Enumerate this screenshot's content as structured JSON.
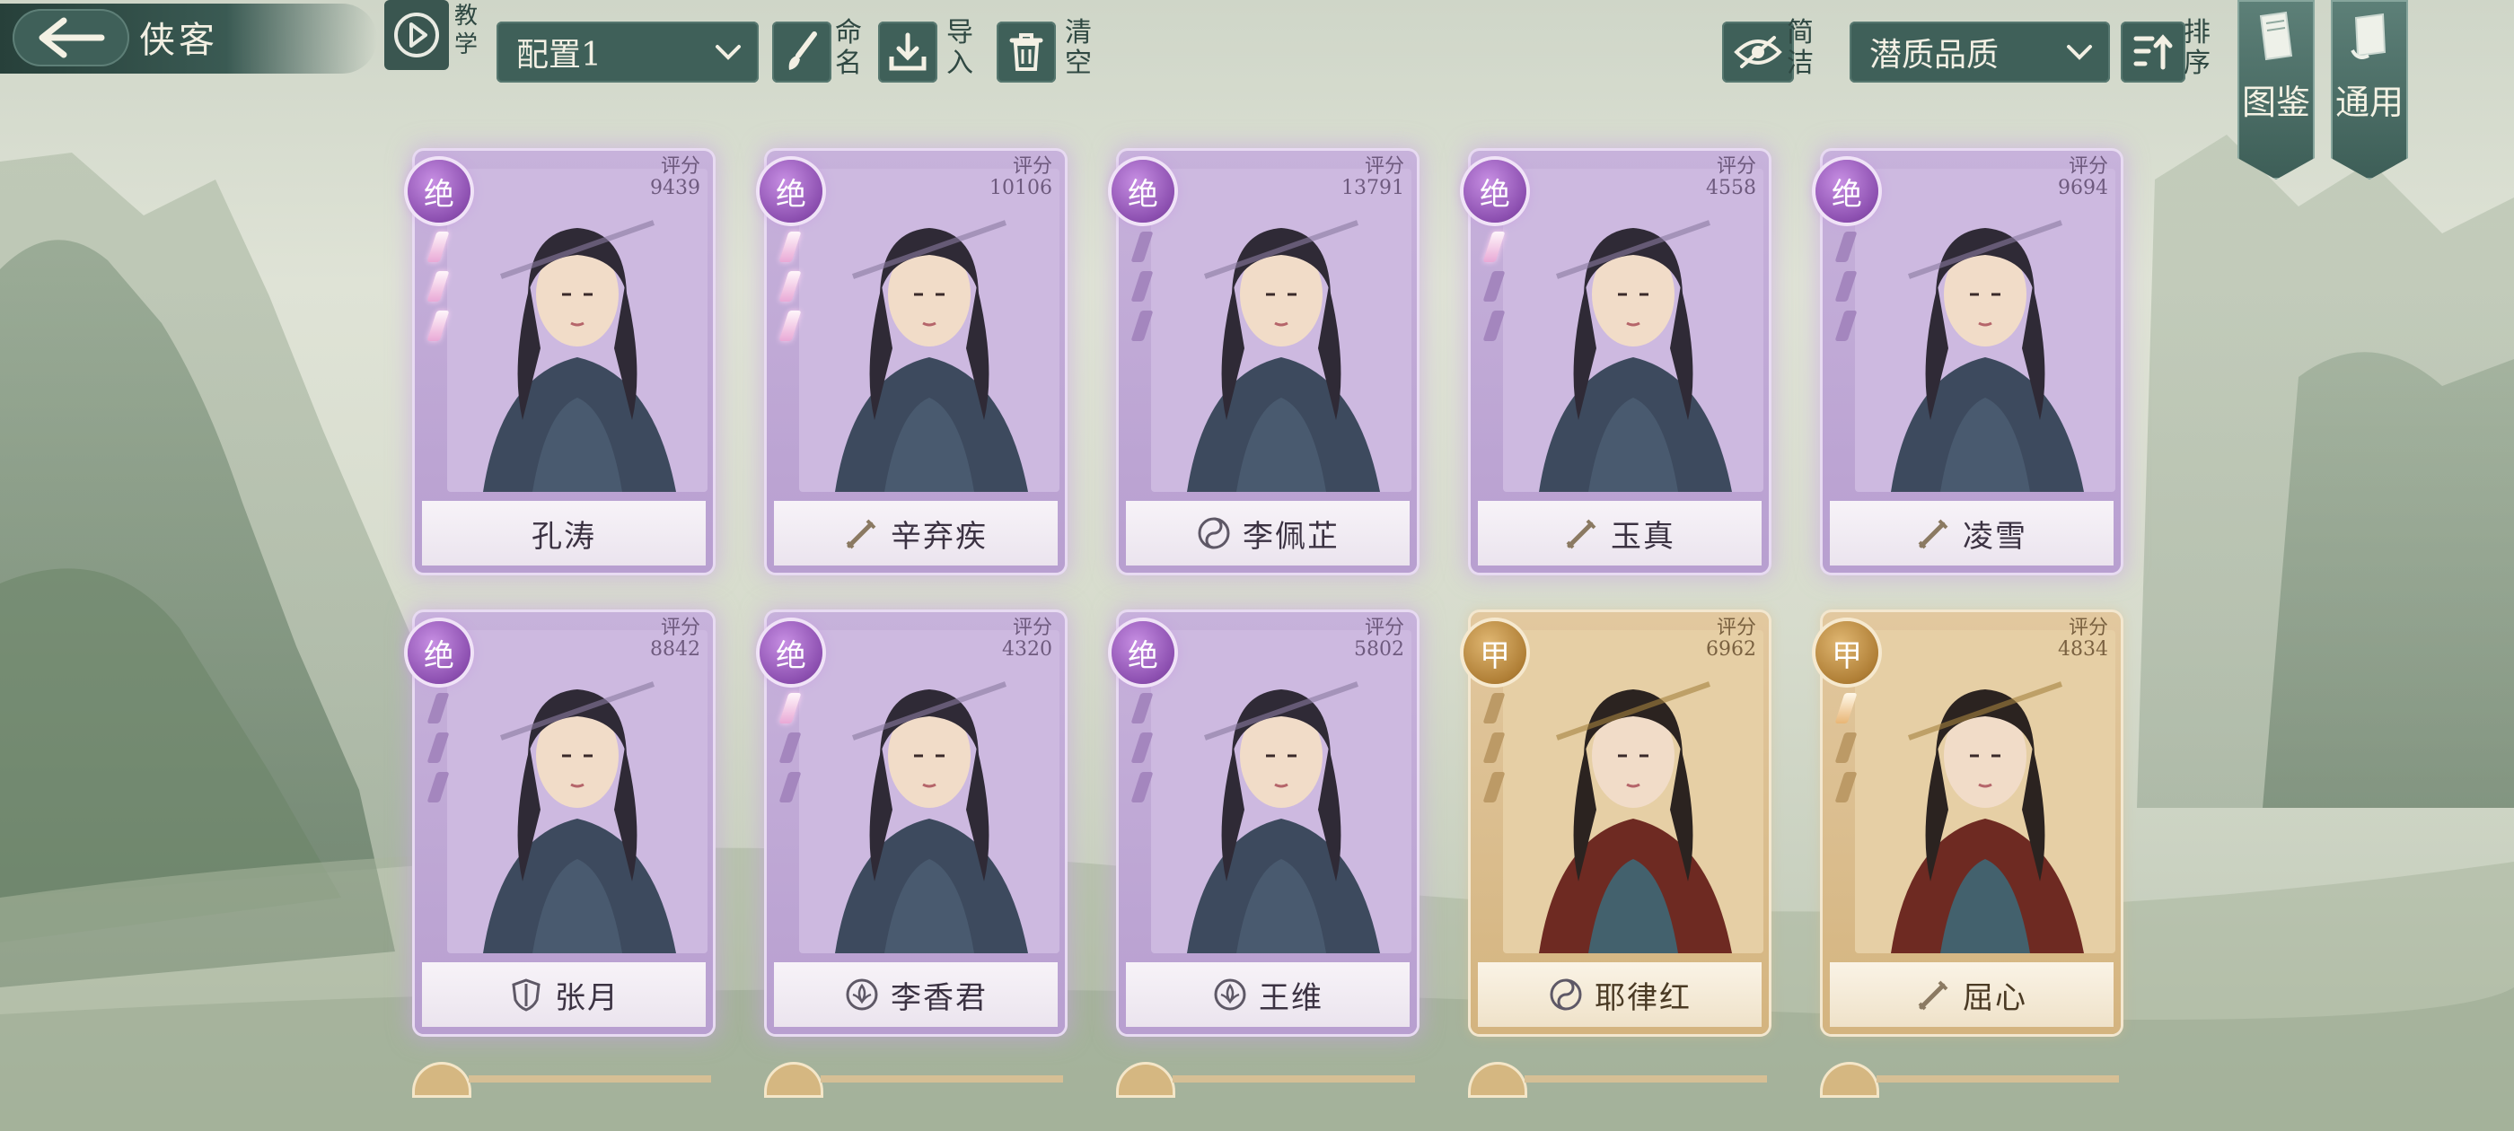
{
  "header": {
    "title": "侠客",
    "tutorial_label": "教学",
    "config_select": "配置1",
    "rename_label": "命名",
    "import_label": "导入",
    "clear_label": "清空",
    "simple_label": "简洁",
    "sort_select": "潜质品质",
    "sort_label": "排序",
    "codex_label": "图鉴",
    "general_label": "通用"
  },
  "score_caption": "评分",
  "cards": [
    {
      "name": "孔涛",
      "score": "9439",
      "rank": "绝",
      "tier": "jue",
      "stars_lit": 3,
      "class_icon": "none-icon"
    },
    {
      "name": "辛弃疾",
      "score": "10106",
      "rank": "绝",
      "tier": "jue",
      "stars_lit": 3,
      "class_icon": "sword-icon"
    },
    {
      "name": "李佩芷",
      "score": "13791",
      "rank": "绝",
      "tier": "jue",
      "stars_lit": 0,
      "class_icon": "taiji-icon"
    },
    {
      "name": "玉真",
      "score": "4558",
      "rank": "绝",
      "tier": "jue",
      "stars_lit": 1,
      "class_icon": "sword-icon"
    },
    {
      "name": "凌雪",
      "score": "9694",
      "rank": "绝",
      "tier": "jue",
      "stars_lit": 0,
      "class_icon": "sword-icon"
    },
    {
      "name": "张月",
      "score": "8842",
      "rank": "绝",
      "tier": "jue",
      "stars_lit": 0,
      "class_icon": "shield-icon"
    },
    {
      "name": "李香君",
      "score": "4320",
      "rank": "绝",
      "tier": "jue",
      "stars_lit": 1,
      "class_icon": "lotus-icon"
    },
    {
      "name": "王维",
      "score": "5802",
      "rank": "绝",
      "tier": "jue",
      "stars_lit": 0,
      "class_icon": "lotus-icon"
    },
    {
      "name": "耶律红",
      "score": "6962",
      "rank": "甲",
      "tier": "jia",
      "stars_lit": 0,
      "class_icon": "taiji-icon"
    },
    {
      "name": "屈心",
      "score": "4834",
      "rank": "甲",
      "tier": "jia",
      "stars_lit": 1,
      "class_icon": "sword-icon"
    }
  ],
  "colors": {
    "jue": "#b89fd0",
    "jia": "#d4b47f",
    "ui_teal": "#3f6059"
  }
}
